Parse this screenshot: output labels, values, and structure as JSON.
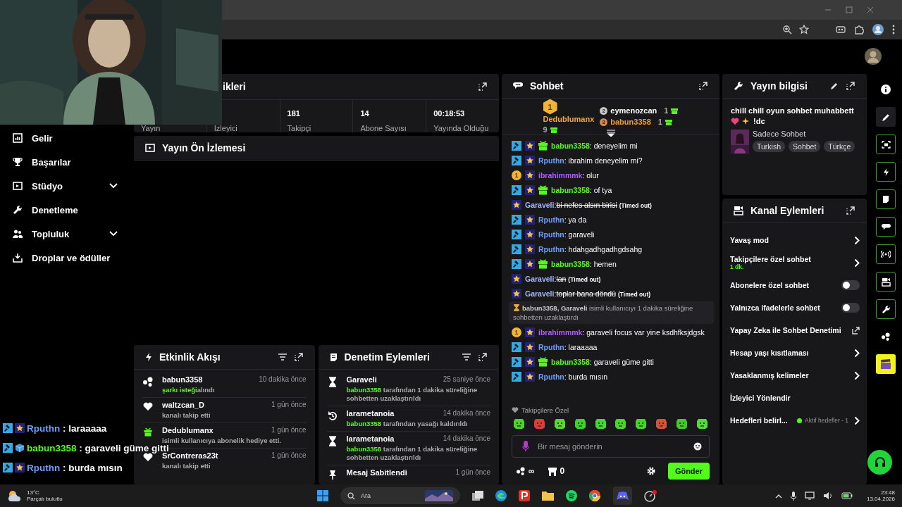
{
  "sidebar": {
    "items": [
      {
        "label": "Gelir",
        "kind": "link"
      },
      {
        "label": "Başarılar",
        "kind": "link"
      },
      {
        "label": "Stüdyo",
        "kind": "group",
        "expanded": false
      },
      {
        "label": "Denetleme",
        "kind": "link"
      },
      {
        "label": "Topluluk",
        "kind": "group",
        "expanded": false
      },
      {
        "label": "Droplar ve ödüller",
        "kind": "link"
      }
    ]
  },
  "stats": {
    "title": "ikleri",
    "cells": [
      {
        "label": "Yayın"
      },
      {
        "label": "İzleyici"
      },
      {
        "value": "181",
        "label": "Takipçi"
      },
      {
        "value": "14",
        "label": "Abone Sayısı"
      },
      {
        "value": "00:18:53",
        "label": "Yayında Olduğu"
      }
    ]
  },
  "preview": {
    "title": "Yayın Ön İzlemesi"
  },
  "activity": {
    "title": "Etkinlik Akışı",
    "items": [
      {
        "kind": "drops",
        "user": "babun3358",
        "time": "10 dakika önce",
        "highlight": "şarkı isteği",
        "text": "alındı"
      },
      {
        "kind": "follow",
        "user": "waltzcan_D",
        "time": "1 gün önce",
        "text": "kanalı takip etti"
      },
      {
        "kind": "gift",
        "user": "Dedublumanx",
        "time": "1 gün önce",
        "text": "isimli kullanıcıya abonelik hediye etti."
      },
      {
        "kind": "follow",
        "user": "SrContreras23t",
        "time": "1 gün önce",
        "text": "kanalı takip etti"
      }
    ]
  },
  "moderation": {
    "title": "Denetim Eylemleri",
    "items": [
      {
        "kind": "timeout",
        "user": "Garaveli",
        "time": "25 saniye önce",
        "actor": "babun3358",
        "text": "tarafından 1 dakika süreliğine sohbetten uzaklaştırıldı"
      },
      {
        "kind": "unban",
        "user": "larametanoia",
        "time": "14 dakika önce",
        "actor": "babun3358",
        "text": "tarafından yasağı kaldırıldı"
      },
      {
        "kind": "timeout",
        "user": "larametanoia",
        "time": "14 dakika önce",
        "actor": "babun3358",
        "text": "tarafından 1 dakika süreliğine sohbetten uzaklaştırıldı"
      },
      {
        "kind": "pin",
        "user": "Mesaj Sabitlendi",
        "time": "1 gün önce"
      }
    ]
  },
  "chat": {
    "title": "Sohbet",
    "leaders": [
      {
        "rank": "1",
        "name": "Dedublumanx",
        "count": "9",
        "color": "#f0a83c"
      },
      {
        "rank": "2",
        "name": "eymenozcan",
        "count": "1",
        "color": "#ffffff"
      },
      {
        "rank": "3",
        "name": "babun3358",
        "count": "1",
        "color": "#f39a3a"
      }
    ],
    "messages": [
      {
        "kind": "message",
        "badges": [
          {
            "kind": "mod"
          },
          {
            "kind": "star"
          },
          {
            "kind": "gift"
          }
        ],
        "user": "babun3358",
        "color": "#53fc18",
        "text": ": deneyelim mi"
      },
      {
        "kind": "message",
        "badges": [
          {
            "kind": "mod"
          },
          {
            "kind": "star"
          }
        ],
        "user": "Rputhn",
        "color": "#6f9dff",
        "text": ": ibrahim deneyelim mi?"
      },
      {
        "kind": "message",
        "badges": [
          {
            "kind": "rank",
            "label": "1"
          },
          {
            "kind": "star"
          }
        ],
        "user": "ibrahimmmk",
        "color": "#b35cff",
        "text": ": olur"
      },
      {
        "kind": "message",
        "badges": [
          {
            "kind": "mod"
          },
          {
            "kind": "star"
          },
          {
            "kind": "gift"
          }
        ],
        "user": "babun3358",
        "color": "#53fc18",
        "text": ": of tya"
      },
      {
        "kind": "message",
        "badges": [
          {
            "kind": "star"
          }
        ],
        "user": "Garaveli",
        "color": "#a9b8ff",
        "text": ":",
        "deleted": "bi nefes alsın birisi",
        "note": "(Timed out)"
      },
      {
        "kind": "message",
        "badges": [
          {
            "kind": "mod"
          },
          {
            "kind": "star"
          }
        ],
        "user": "Rputhn",
        "color": "#6f9dff",
        "text": ": ya da"
      },
      {
        "kind": "message",
        "badges": [
          {
            "kind": "mod"
          },
          {
            "kind": "star"
          }
        ],
        "user": "Rputhn",
        "color": "#6f9dff",
        "text": ": garaveli"
      },
      {
        "kind": "message",
        "badges": [
          {
            "kind": "mod"
          },
          {
            "kind": "star"
          }
        ],
        "user": "Rputhn",
        "color": "#6f9dff",
        "text": ": hdahgadhgadhgdsahg"
      },
      {
        "kind": "message",
        "badges": [
          {
            "kind": "mod"
          },
          {
            "kind": "star"
          },
          {
            "kind": "gift"
          }
        ],
        "user": "babun3358",
        "color": "#53fc18",
        "text": ": hemen"
      },
      {
        "kind": "message",
        "badges": [
          {
            "kind": "star"
          }
        ],
        "user": "Garaveli",
        "color": "#a9b8ff",
        "text": ":",
        "deleted": "lan",
        "note": "(Timed out)"
      },
      {
        "kind": "message",
        "badges": [
          {
            "kind": "star"
          }
        ],
        "user": "Garaveli",
        "color": "#a9b8ff",
        "text": ":",
        "deleted": "toplar bana döndü",
        "note": "(Timed out)"
      },
      {
        "kind": "notice",
        "actors": "babun3358, Garaveli",
        "text": "isimli kullanıcıyı 1 dakika süreliğine sohbetten uzaklaştırdı"
      },
      {
        "kind": "message",
        "badges": [
          {
            "kind": "rank",
            "label": "1"
          },
          {
            "kind": "star"
          }
        ],
        "user": "ibrahimmmk",
        "color": "#b35cff",
        "text": ": garaveli focus var yine ksdhfksjdgsk"
      },
      {
        "kind": "message",
        "badges": [
          {
            "kind": "mod"
          },
          {
            "kind": "star"
          }
        ],
        "user": "Rputhn",
        "color": "#6f9dff",
        "text": ": laraaaaa"
      },
      {
        "kind": "message",
        "badges": [
          {
            "kind": "mod"
          },
          {
            "kind": "star"
          },
          {
            "kind": "gift"
          }
        ],
        "user": "babun3358",
        "color": "#53fc18",
        "text": ": garaveli güme gitti"
      },
      {
        "kind": "message",
        "badges": [
          {
            "kind": "mod"
          },
          {
            "kind": "star"
          }
        ],
        "user": "Rputhn",
        "color": "#6f9dff",
        "text": ": burda mısın"
      }
    ],
    "emote_label": "Takipçilere Özel",
    "placeholder": "Bir mesaj gönderin",
    "points": "∞",
    "shop_count": "0",
    "send": "Gönder"
  },
  "stream_info": {
    "title": "Yayın bilgisi",
    "stream_title": "chill chill oyun sohbet muhabbett",
    "command": "!dc",
    "category": "Sadece Sohbet",
    "tags": [
      "Turkish",
      "Sohbet",
      "Türkçe"
    ]
  },
  "channel_actions": {
    "title": "Kanal Eylemleri",
    "items": [
      {
        "kind": "link",
        "label": "Yavaş mod"
      },
      {
        "kind": "link",
        "label": "Takipçilere özel sohbet",
        "detail": "1 dk."
      },
      {
        "kind": "toggle",
        "label": "Abonelere özel sohbet",
        "on": false
      },
      {
        "kind": "toggle",
        "label": "Yalnızca ifadelerle sohbet",
        "on": false
      },
      {
        "kind": "external",
        "label": "Yapay Zeka ile Sohbet Denetimi"
      },
      {
        "kind": "link",
        "label": "Hesap yaşı kısıtlaması"
      },
      {
        "kind": "link",
        "label": "Yasaklanmış kelimeler"
      },
      {
        "kind": "plain",
        "label": "İzleyici Yönlendir"
      },
      {
        "kind": "link",
        "label": "Hedefleri belirl...",
        "status": "Aktif hedefler - 1"
      }
    ]
  },
  "rail": [
    {
      "kind": "info",
      "selected": false,
      "pinned": false
    },
    {
      "kind": "edit",
      "selected": true,
      "pinned": false
    },
    {
      "kind": "preview",
      "selected": false,
      "pinned": true
    },
    {
      "kind": "bolt",
      "selected": false,
      "pinned": true
    },
    {
      "kind": "note",
      "selected": false,
      "pinned": true
    },
    {
      "kind": "chat",
      "selected": false,
      "pinned": true
    },
    {
      "kind": "broadcast",
      "selected": false,
      "pinned": true
    },
    {
      "kind": "channel",
      "selected": false,
      "pinned": true
    },
    {
      "kind": "wrench",
      "selected": false,
      "pinned": true
    },
    {
      "kind": "dots",
      "selected": false,
      "pinned": false
    },
    {
      "kind": "clapper",
      "selected": false,
      "pinned": false
    }
  ],
  "overlay": [
    {
      "badges": [
        {
          "kind": "mod"
        },
        {
          "kind": "star"
        }
      ],
      "user": "Rputhn",
      "color": "#6f9dff",
      "text": ": laraaaaa"
    },
    {
      "badges": [
        {
          "kind": "mod"
        },
        {
          "kind": "cube"
        }
      ],
      "user": "babun3358",
      "color": "#53fc18",
      "text": ": garaveli güme gitti"
    },
    {
      "badges": [
        {
          "kind": "mod"
        },
        {
          "kind": "star"
        }
      ],
      "user": "Rputhn",
      "color": "#6f9dff",
      "text": ": burda mısın"
    }
  ],
  "taskbar": {
    "temperature": "13°C",
    "weather": "Parçalı bulutlu",
    "search": "Ara",
    "time": "23:48",
    "date": "13.04.2026"
  }
}
